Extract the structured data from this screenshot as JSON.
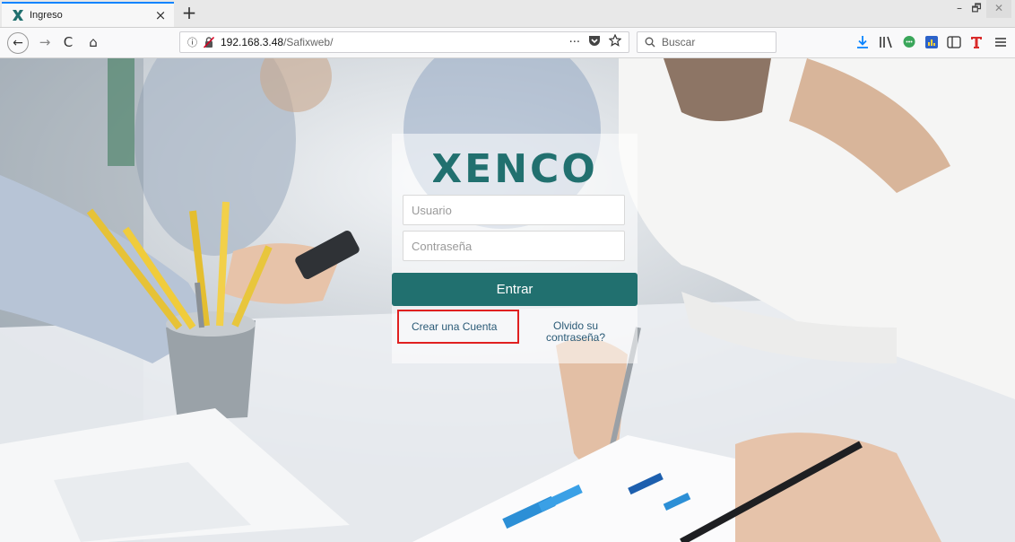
{
  "browser": {
    "tab": {
      "title": "Ingreso"
    },
    "new_tab_label": "+",
    "window": {
      "minimize": "–",
      "maximize": "🗗",
      "close": "✕"
    },
    "nav": {
      "back": "←",
      "forward": "→",
      "reload": "C",
      "home": "⌂"
    },
    "address": {
      "host": "192.168.3.48",
      "path": "/Safixweb/",
      "info": "ⓘ"
    },
    "address_actions": {
      "more": "···"
    },
    "search": {
      "placeholder": "Buscar"
    },
    "toolbar_icons": [
      "download-icon",
      "library-icon",
      "chat-extension-icon",
      "chart-extension-icon",
      "reader-sidebar-icon",
      "t-extension-icon",
      "menu-icon"
    ],
    "colors": {
      "tab_accent": "#0a84ff"
    }
  },
  "login": {
    "brand": "XENCO",
    "username_placeholder": "Usuario",
    "password_placeholder": "Contraseña",
    "submit_label": "Entrar",
    "create_account_label": "Crear una Cuenta",
    "forgot_password_label": "Olvido su contraseña?",
    "colors": {
      "brand": "#21706f",
      "button": "#21706f",
      "link": "#2a5a76",
      "highlight_box": "#e02020"
    }
  }
}
